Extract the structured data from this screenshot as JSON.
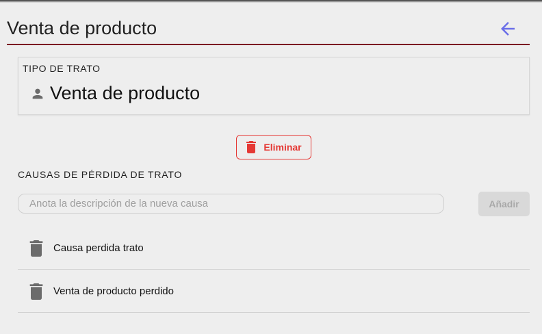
{
  "header": {
    "title": "Venta de producto",
    "back_icon": "arrow-left-icon",
    "accent_color": "#6a6ee8",
    "underline_color": "#7b1522"
  },
  "deal_type": {
    "label": "TIPO DE TRATO",
    "icon": "person-icon",
    "value": "Venta de producto"
  },
  "actions": {
    "delete_label": "Eliminar",
    "delete_icon": "trash-icon",
    "delete_color": "#e53935"
  },
  "loss_causes": {
    "section_title": "CAUSAS DE PÉRDIDA DE TRATO",
    "input_value": "",
    "input_placeholder": "Anota la descripción de la nueva causa",
    "add_label": "Añadir",
    "items": [
      {
        "text": "Causa perdida trato",
        "icon": "trash-icon"
      },
      {
        "text": "Venta de producto perdido",
        "icon": "trash-icon"
      }
    ]
  }
}
